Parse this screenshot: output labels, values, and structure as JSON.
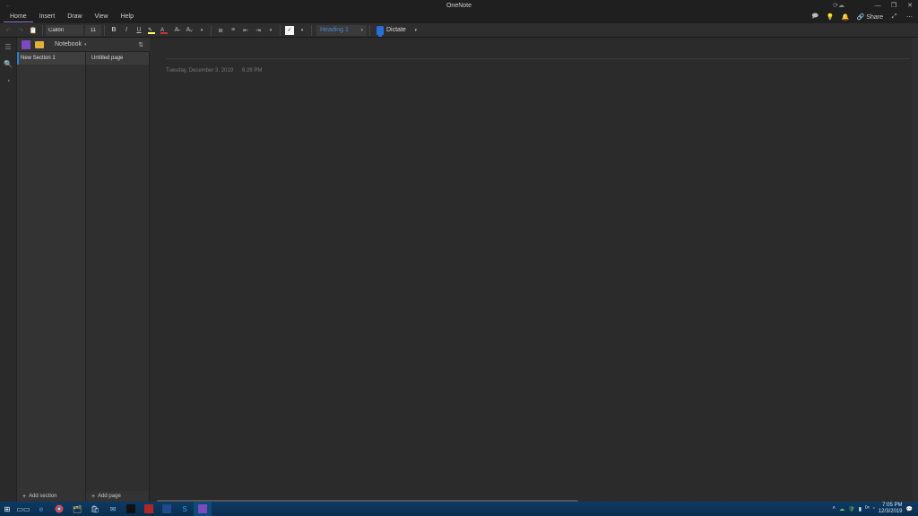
{
  "app": {
    "title": "OneNote"
  },
  "window_controls": {
    "minimize": "—",
    "maximize": "❐",
    "close": "✕"
  },
  "menus": {
    "items": [
      "Home",
      "Insert",
      "Draw",
      "View",
      "Help"
    ],
    "active_index": 0
  },
  "top_right": {
    "share_label": "Share"
  },
  "ribbon": {
    "font_name": "Calibri",
    "font_size": "11",
    "heading_label": "Heading 1",
    "dictate_label": "Dictate",
    "highlight_color": "#ffff66",
    "font_color": "#cc3333"
  },
  "notebook": {
    "name": "Notebook",
    "section_name": "New Section 1",
    "page_name": "Untitled page"
  },
  "add": {
    "section_label": "Add section",
    "page_label": "Add page"
  },
  "page": {
    "date": "Tuesday, December 3, 2019",
    "time": "6:28 PM"
  },
  "taskbar": {
    "time": "7:05 PM",
    "date": "12/3/2019",
    "sound_text": "ᴰˣ"
  }
}
